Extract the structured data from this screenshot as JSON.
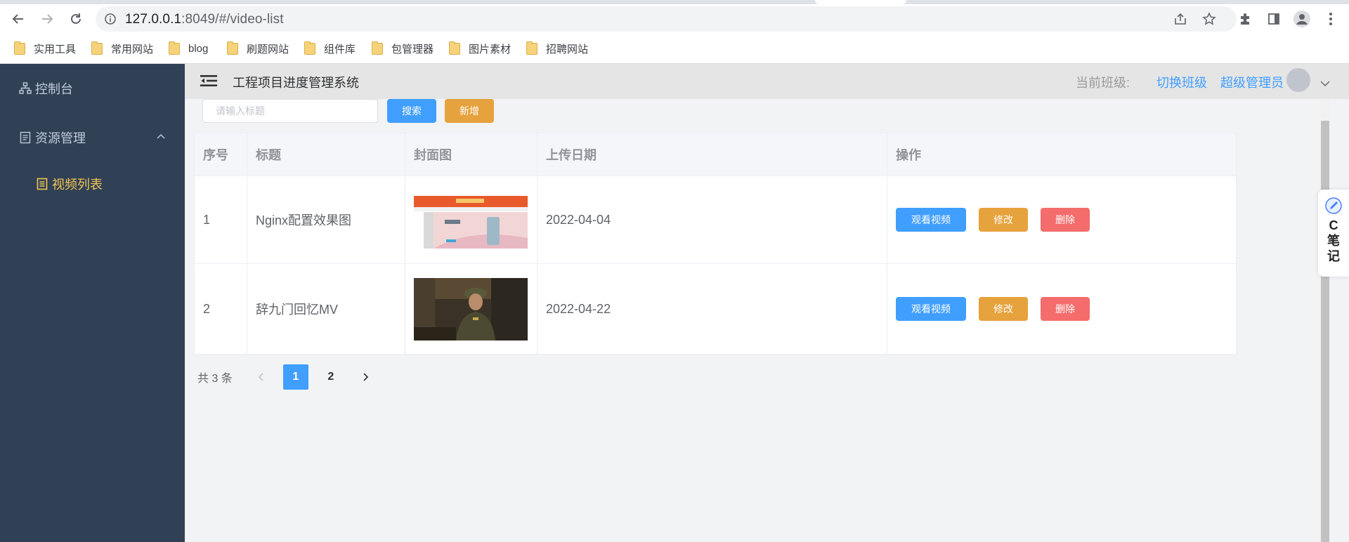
{
  "browser": {
    "url_host": "127.0.0.1",
    "url_rest": ":8049/#/video-list",
    "bookmarks": [
      "实用工具",
      "常用网站",
      "blog",
      "刷题网站",
      "组件库",
      "包管理器",
      "图片素材",
      "招聘网站"
    ]
  },
  "sidebar": {
    "items": [
      {
        "label": "控制台",
        "icon": "sitemap-icon"
      },
      {
        "label": "资源管理",
        "icon": "document-icon",
        "expanded": true,
        "children": [
          {
            "label": "视频列表",
            "icon": "list-icon",
            "active": true
          }
        ]
      }
    ]
  },
  "header": {
    "title": "工程项目进度管理系统",
    "current_class_label": "当前班级:",
    "switch_class": "切换班级",
    "user_name": "超级管理员"
  },
  "toolbar": {
    "search_placeholder": "请输入标题",
    "search_button": "搜索",
    "add_button": "新增"
  },
  "table": {
    "headers": [
      "序号",
      "标题",
      "封面图",
      "上传日期",
      "操作"
    ],
    "rows": [
      {
        "index": "1",
        "title": "Nginx配置效果图",
        "date": "2022-04-04"
      },
      {
        "index": "2",
        "title": "辞九门回忆MV",
        "date": "2022-04-22"
      }
    ],
    "actions": {
      "watch": "观看视频",
      "edit": "修改",
      "delete": "删除"
    }
  },
  "pagination": {
    "total_text": "共 3 条",
    "pages": [
      "1",
      "2"
    ],
    "current": "1"
  },
  "side_widget": {
    "text": "C笔记"
  },
  "colors": {
    "primary": "#409eff",
    "warning": "#e6a23c",
    "danger": "#f56c6c",
    "sidebar_bg": "#304156",
    "sidebar_active": "#f4c553"
  }
}
